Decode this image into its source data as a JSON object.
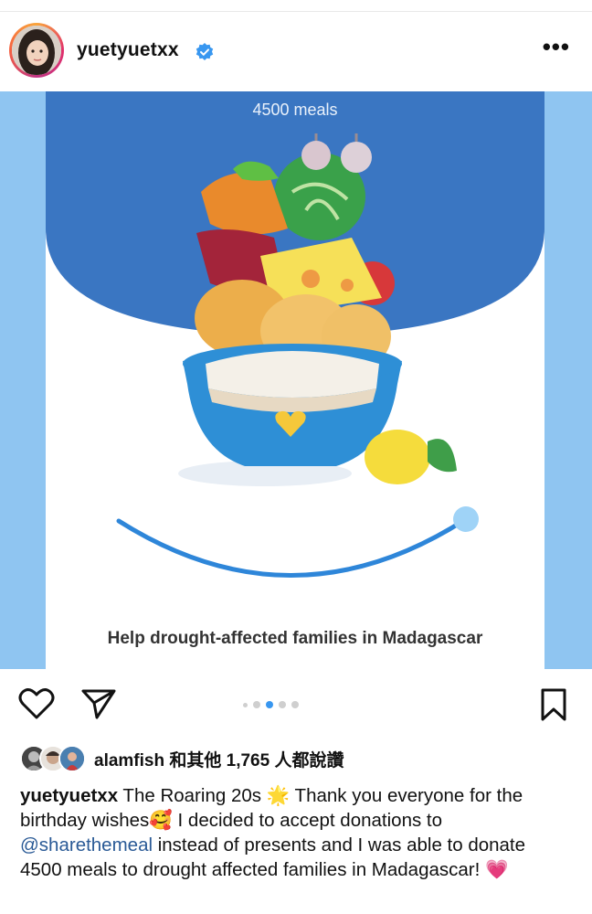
{
  "header": {
    "username": "yuetyuetxx",
    "more_icon": "more-horizontal-icon"
  },
  "post": {
    "meals_count": "4500 meals",
    "help_text": "Help drought-affected families in Madagascar",
    "carousel": {
      "total": 5,
      "active": 3
    },
    "colors": {
      "sky": "#8fc5f1",
      "dome": "#3a76c2",
      "bowl": "#2e8fd6",
      "heart": "#f5c83a"
    }
  },
  "actions": {
    "like_icon": "heart-outline-icon",
    "share_icon": "send-icon",
    "save_icon": "bookmark-icon"
  },
  "likes": {
    "text": "alamfish 和其他 1,765 人都說讚"
  },
  "caption": {
    "username": "yuetyuetxx",
    "part1": " The Roaring 20s ",
    "emoji1": "🌟",
    "part2": " Thank you everyone for the birthday wishes",
    "emoji2": "🥰",
    "part3": " I decided to accept donations to ",
    "mention": "@sharethemeal",
    "part4": " instead of presents and I was able to donate 4500 meals to drought affected families in Madagascar! ",
    "emoji3": "💗"
  }
}
